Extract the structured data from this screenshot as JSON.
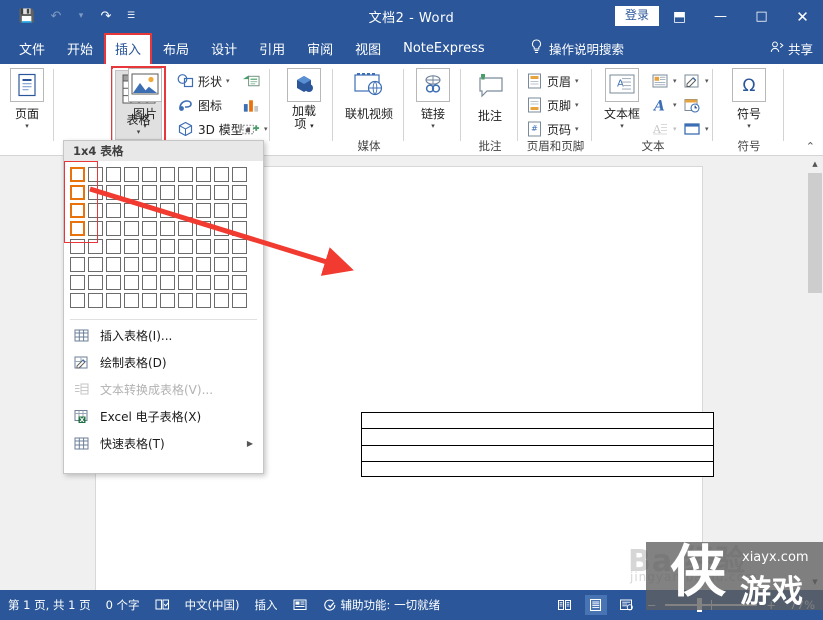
{
  "titlebar": {
    "document_title": "文档2  -  Word",
    "quick_access": [
      {
        "name": "save-icon",
        "glyph": "💾"
      },
      {
        "name": "undo-icon",
        "glyph": "↶"
      },
      {
        "name": "undo-caret-icon",
        "glyph": "▾"
      },
      {
        "name": "redo-icon",
        "glyph": "↷"
      },
      {
        "name": "customize-qat-icon",
        "glyph": "☰"
      }
    ],
    "signin_label": "登录",
    "ribbon_display_glyph": "⬒",
    "minimize_glyph": "—",
    "maximize_glyph": "□",
    "close_glyph": "✕"
  },
  "tabs": [
    {
      "label": "文件",
      "active": false
    },
    {
      "label": "开始",
      "active": false
    },
    {
      "label": "插入",
      "active": true
    },
    {
      "label": "布局",
      "active": false
    },
    {
      "label": "设计",
      "active": false
    },
    {
      "label": "引用",
      "active": false
    },
    {
      "label": "审阅",
      "active": false
    },
    {
      "label": "视图",
      "active": false
    },
    {
      "label": "NoteExpress",
      "active": false
    }
  ],
  "tellme": {
    "label": "操作说明搜索",
    "icon": "lightbulb-icon"
  },
  "share": {
    "label": "共享",
    "icon": "person-share-icon"
  },
  "ribbon": {
    "collapse_glyph": "⌃",
    "groups": [
      {
        "name": "pages",
        "label": "",
        "buttons": [
          {
            "label": "页面",
            "caret": "▾"
          }
        ]
      },
      {
        "name": "tables",
        "label": "",
        "buttons": [
          {
            "label": "表格",
            "caret": "▾"
          }
        ]
      },
      {
        "name": "illustrations",
        "label": "",
        "buttons": [
          {
            "label": "图片",
            "caret": "▾"
          }
        ],
        "small": [
          {
            "label": "形状",
            "caret": "▾",
            "icon": "shapes-icon"
          },
          {
            "label": "图标",
            "caret": "",
            "icon": "icons-icon"
          },
          {
            "label": "3D 模型",
            "caret": "▾",
            "icon": "3d-model-icon"
          },
          {
            "label": "",
            "caret": "",
            "icon": "smartart-icon"
          },
          {
            "label": "",
            "caret": "",
            "icon": "chart-icon"
          },
          {
            "label": "",
            "caret": "▾",
            "icon": "screenshot-icon"
          }
        ]
      },
      {
        "name": "addins",
        "label": "",
        "buttons": [
          {
            "label": "加载\n项",
            "caret": "▾"
          }
        ]
      },
      {
        "name": "media",
        "label": "媒体",
        "buttons": [
          {
            "label": "联机视频",
            "caret": ""
          }
        ]
      },
      {
        "name": "links",
        "label": "",
        "buttons": [
          {
            "label": "链接",
            "caret": "▾"
          }
        ]
      },
      {
        "name": "comments",
        "label": "批注",
        "buttons": [
          {
            "label": "批注",
            "caret": ""
          }
        ]
      },
      {
        "name": "header-footer",
        "label": "页眉和页脚",
        "small": [
          {
            "label": "页眉",
            "caret": "▾",
            "icon": "header-icon"
          },
          {
            "label": "页脚",
            "caret": "▾",
            "icon": "footer-icon"
          },
          {
            "label": "页码",
            "caret": "▾",
            "icon": "page-number-icon"
          }
        ]
      },
      {
        "name": "text",
        "label": "文本",
        "buttons": [
          {
            "label": "文本框",
            "caret": "▾"
          }
        ],
        "small": [
          {
            "label": "",
            "caret": "▾",
            "icon": "quick-parts-icon"
          },
          {
            "label": "",
            "caret": "▾",
            "icon": "signature-line-icon"
          },
          {
            "label": "",
            "caret": "▾",
            "icon": "wordart-icon"
          },
          {
            "label": "",
            "caret": "",
            "icon": "date-time-icon"
          },
          {
            "label": "",
            "caret": "▾",
            "icon": "drop-cap-icon",
            "disabled": true
          },
          {
            "label": "",
            "caret": "▾",
            "icon": "object-icon"
          }
        ]
      },
      {
        "name": "symbols",
        "label": "符号",
        "buttons": [
          {
            "label": "符号",
            "caret": "▾"
          }
        ]
      }
    ]
  },
  "table_menu": {
    "header_label": "1x4 表格",
    "grid": {
      "cols": 10,
      "rows": 8,
      "selected_cols": 1,
      "selected_rows": 4
    },
    "items": [
      {
        "label": "插入表格(I)...",
        "icon": "insert-table-icon",
        "disabled": false,
        "submenu": false
      },
      {
        "label": "绘制表格(D)",
        "icon": "draw-table-icon",
        "disabled": false,
        "submenu": false
      },
      {
        "label": "文本转换成表格(V)...",
        "icon": "text-to-table-icon",
        "disabled": true,
        "submenu": false
      },
      {
        "label": "Excel 电子表格(X)",
        "icon": "excel-spreadsheet-icon",
        "disabled": false,
        "submenu": false
      },
      {
        "label": "快速表格(T)",
        "icon": "quick-tables-icon",
        "disabled": false,
        "submenu": true
      }
    ],
    "submenu_arrow": "▶"
  },
  "document": {
    "table": {
      "columns": 1,
      "rows": 4
    }
  },
  "annotation": {
    "arrow_color": "#f23b30",
    "selection_box_color": "#e8373a",
    "selected_cell_color": "#e8730c"
  },
  "statusbar": {
    "page_info": "第 1 页, 共 1 页",
    "word_count": "0 个字",
    "proofing_icon": "proofing-icon",
    "language": "中文(中国)",
    "insert_mode": "插入",
    "macro_icon": "macro-record-icon",
    "accessibility": "辅助功能: 一切就绪",
    "views": [
      {
        "name": "read-mode",
        "glyph": "☷",
        "active": false
      },
      {
        "name": "print-layout",
        "glyph": "☰",
        "active": true
      },
      {
        "name": "web-layout",
        "glyph": "⊞",
        "active": false
      }
    ],
    "zoom_out": "−",
    "zoom_in": "+",
    "zoom_value": "77%"
  },
  "watermark": {
    "baidu_line1": "Ba   经验",
    "baidu_line2": "jingyan.baidu.com",
    "logo_char": "侠",
    "site": "xiayx.com",
    "game": "游戏"
  }
}
